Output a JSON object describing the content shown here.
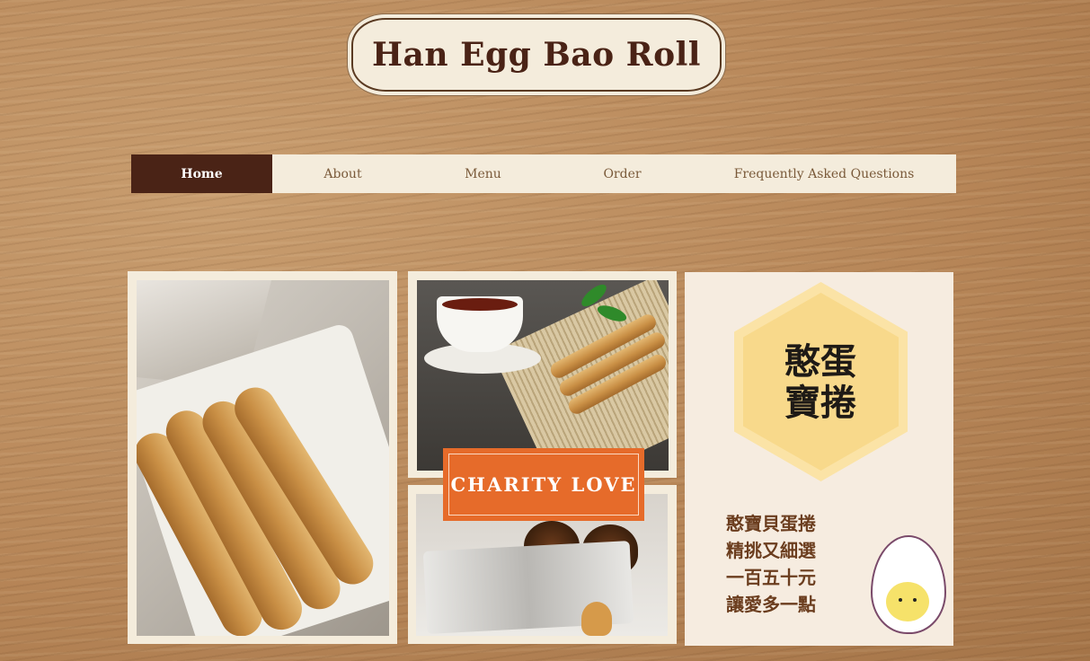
{
  "site": {
    "title": "Han Egg Bao Roll"
  },
  "nav": {
    "items": [
      {
        "label": "Home",
        "active": true
      },
      {
        "label": "About",
        "active": false
      },
      {
        "label": "Menu",
        "active": false
      },
      {
        "label": "Order",
        "active": false
      },
      {
        "label": "Frequently Asked Questions",
        "active": false
      }
    ]
  },
  "banner": {
    "text": "CHARITY  LOVE"
  },
  "logo": {
    "line1": "憨蛋",
    "line2": "寶捲"
  },
  "slogan": {
    "lines": [
      "憨寶貝蛋捲",
      "精挑又細選",
      "一百五十元",
      "讓愛多一點"
    ]
  },
  "colors": {
    "nav_active": "#4a2316",
    "banner": "#e66b2a",
    "hexagon": "#f8d98b",
    "title": "#4a2316"
  }
}
